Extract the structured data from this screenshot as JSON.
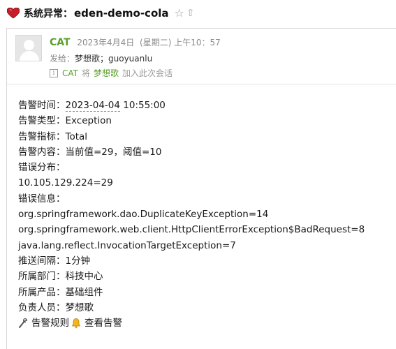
{
  "subject": {
    "prefix": "系统异常：",
    "title": "eden-demo-cola"
  },
  "header": {
    "sender_name": "CAT",
    "date": "2023年4月4日",
    "weekday": "(星期二)",
    "time": "上午10：57",
    "to_label": "发给：",
    "to_value": "梦想歌；guoyuanlu",
    "info_who": "CAT",
    "info_mid": "将",
    "info_link": "梦想歌",
    "info_tail": "加入此次会话"
  },
  "body": {
    "alert_time_label": "告警时间：",
    "alert_time_value": "2023-04-04",
    "alert_time_clock": " 10:55:00",
    "alert_type_label": "告警类型：",
    "alert_type_value": "Exception",
    "alert_metric_label": "告警指标：",
    "alert_metric_value": "Total",
    "alert_content_label": "告警内容：",
    "alert_content_value": "当前值=29，阈值=10",
    "error_dist_label": "错误分布：",
    "error_dist_value": "10.105.129.224=29",
    "error_info_label": "错误信息：",
    "errors": [
      "org.springframework.dao.DuplicateKeyException=14",
      "org.springframework.web.client.HttpClientErrorException$BadRequest=8",
      "java.lang.reflect.InvocationTargetException=7"
    ],
    "push_interval_label": "推送间隔：",
    "push_interval_value": "1分钟",
    "department_label": "所属部门：",
    "department_value": "科技中心",
    "product_label": "所属产品：",
    "product_value": "基础组件",
    "owner_label": "负责人员：",
    "owner_value": "梦想歌",
    "action_rules": "告警规则",
    "action_view": "查看告警"
  }
}
